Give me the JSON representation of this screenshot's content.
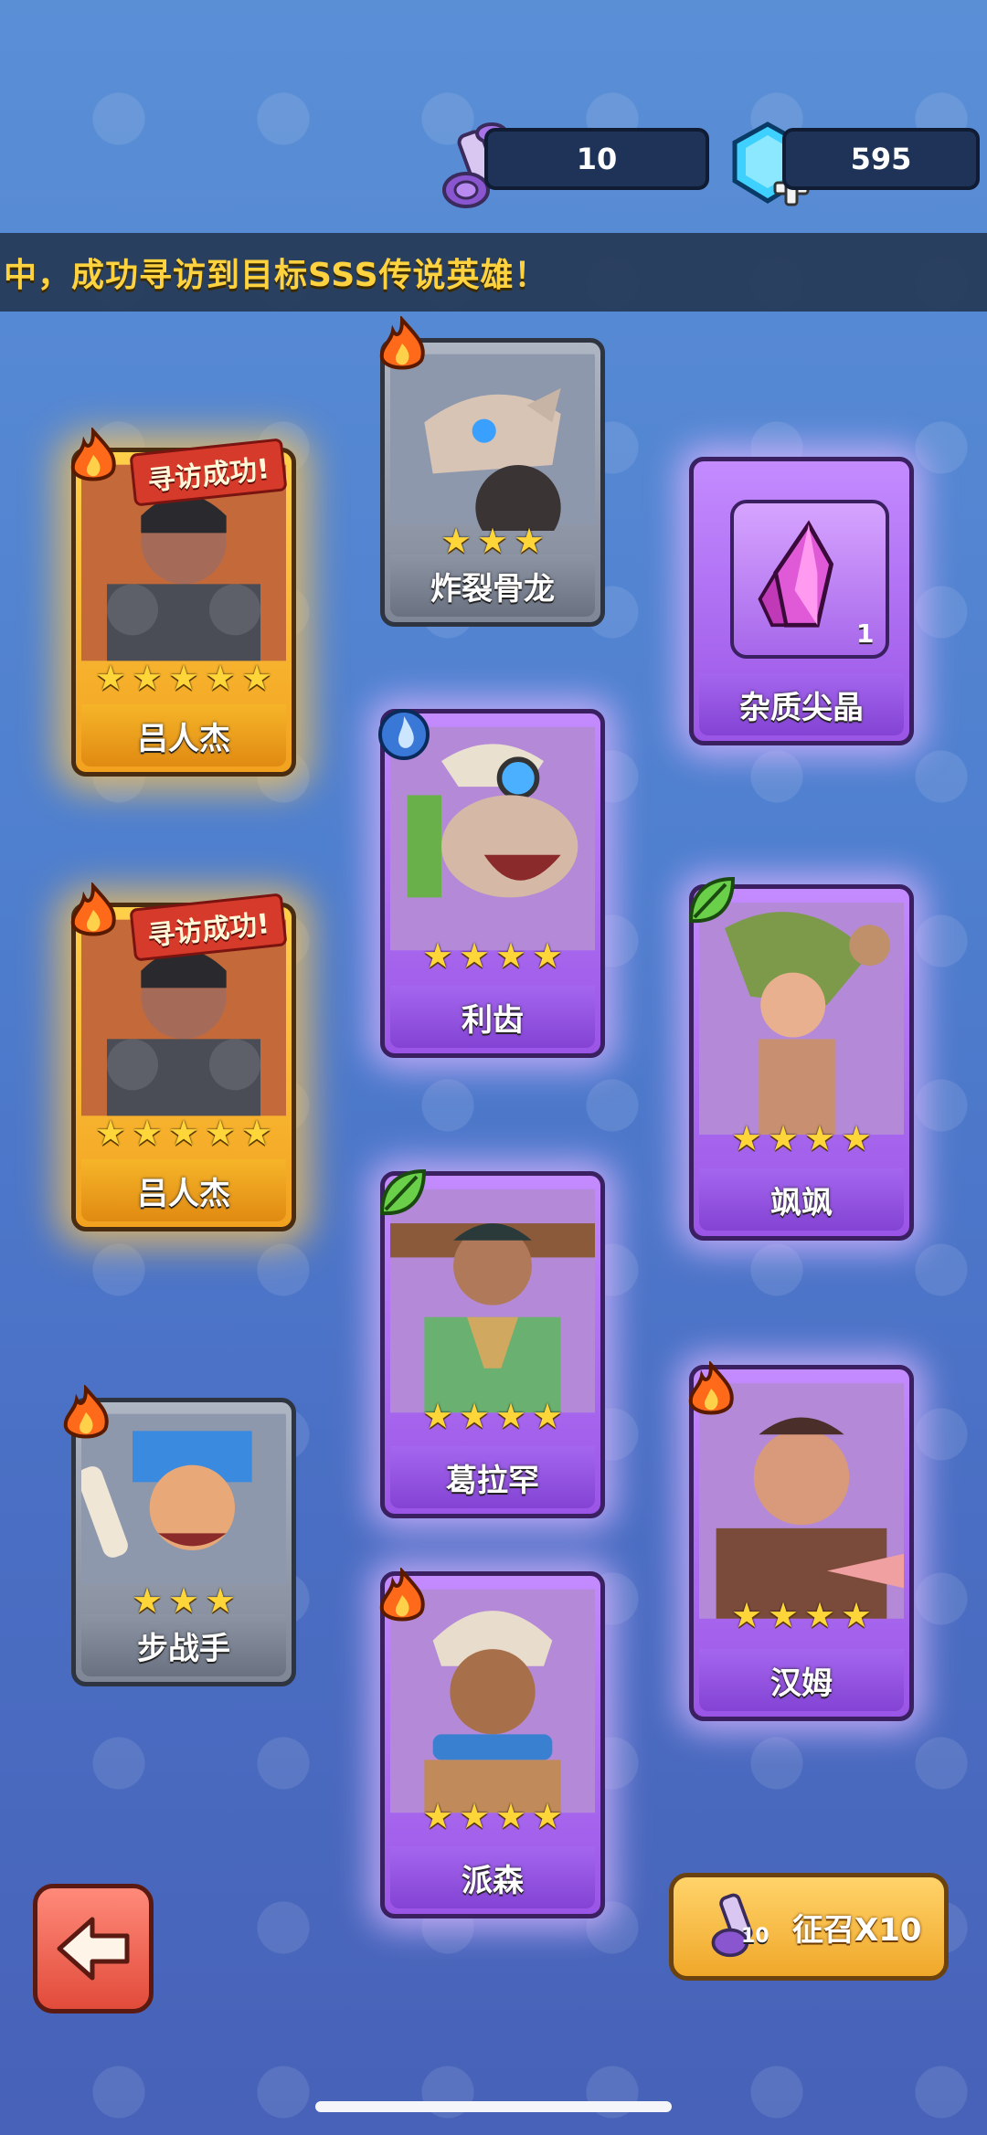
{
  "currency": {
    "scrolls": "10",
    "gems": "595"
  },
  "banner_text": "中，成功寻访到目标SSS传说英雄！",
  "colors": {
    "gold": "#f6b529",
    "purple": "#9a55e6",
    "gray": "#8d95a5",
    "banner_text": "#ffd23f"
  },
  "cards": [
    {
      "name": "吕人杰",
      "rarity": "gold",
      "stars": 5,
      "element": "fire",
      "ribbon": "寻访成功!"
    },
    {
      "name": "炸裂骨龙",
      "rarity": "gray",
      "stars": 3,
      "element": "fire"
    },
    {
      "name": "杂质尖晶",
      "rarity": "purple",
      "item_count": "1",
      "icon": "crystal-icon"
    },
    {
      "name": "利齿",
      "rarity": "purple",
      "stars": 4,
      "element": "water"
    },
    {
      "name": "吕人杰",
      "rarity": "gold",
      "stars": 5,
      "element": "fire",
      "ribbon": "寻访成功!"
    },
    {
      "name": "飒飒",
      "rarity": "purple",
      "stars": 4,
      "element": "leaf"
    },
    {
      "name": "葛拉罕",
      "rarity": "purple",
      "stars": 4,
      "element": "leaf"
    },
    {
      "name": "步战手",
      "rarity": "gray",
      "stars": 3,
      "element": "fire"
    },
    {
      "name": "汉姆",
      "rarity": "purple",
      "stars": 4,
      "element": "fire"
    },
    {
      "name": "派森",
      "rarity": "purple",
      "stars": 4,
      "element": "fire"
    }
  ],
  "summon_button": {
    "label": "征召X10",
    "cost": "10"
  },
  "icons": {
    "back": "arrow-left-icon",
    "scroll": "scroll-icon",
    "gem": "gem-plus-icon"
  }
}
